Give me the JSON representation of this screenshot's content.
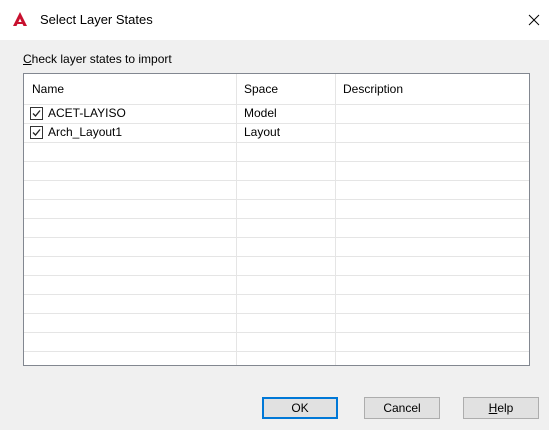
{
  "window": {
    "title": "Select Layer States",
    "icon": "autocad-logo-icon",
    "accent_color": "#c8102e"
  },
  "instruction": {
    "mnemonic": "C",
    "rest": "heck layer states to import"
  },
  "table": {
    "columns": [
      "Name",
      "Space",
      "Description"
    ],
    "rows": [
      {
        "checked": true,
        "name": "ACET-LAYISO",
        "space": "Model",
        "description": ""
      },
      {
        "checked": true,
        "name": "Arch_Layout1",
        "space": "Layout",
        "description": ""
      }
    ]
  },
  "buttons": {
    "ok": "OK",
    "cancel": "Cancel",
    "help_mnemonic": "H",
    "help_rest": "elp"
  },
  "colors": {
    "default_button_border": "#0078d7",
    "list_border": "#828790",
    "dialog_bg": "#f0f0f0"
  }
}
